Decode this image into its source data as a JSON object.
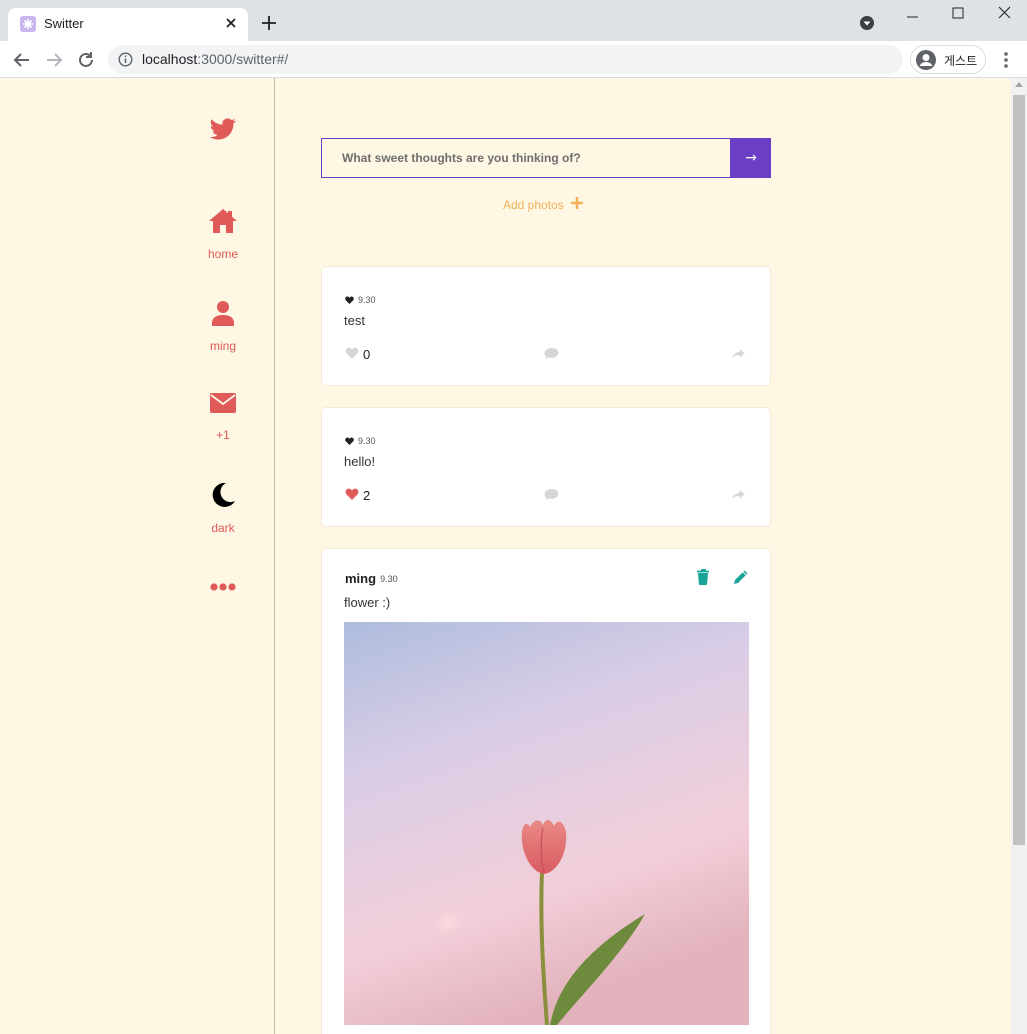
{
  "browser": {
    "tab_title": "Switter",
    "url_host": "localhost",
    "url_rest": ":3000/switter#/",
    "profile_label": "게스트"
  },
  "sidebar": {
    "items": [
      {
        "label": "home"
      },
      {
        "label": "ming"
      },
      {
        "label": "+1"
      },
      {
        "label": "dark"
      }
    ]
  },
  "compose": {
    "placeholder": "What sweet thoughts are you thinking of?",
    "submit_label": "→",
    "add_photos_label": "Add photos"
  },
  "feed": [
    {
      "date": "9.30",
      "text": "test",
      "likes": "0",
      "liked": false
    },
    {
      "date": "9.30",
      "text": "hello!",
      "likes": "2",
      "liked": true
    },
    {
      "author": "ming",
      "date": "9.30",
      "text": "flower :)",
      "has_photo": true
    }
  ],
  "colors": {
    "accent": "#e05a5a",
    "purple": "#6a3fc6",
    "background": "#fef7e4",
    "teal": "#17a398",
    "photo_orange": "#f2b25a"
  }
}
